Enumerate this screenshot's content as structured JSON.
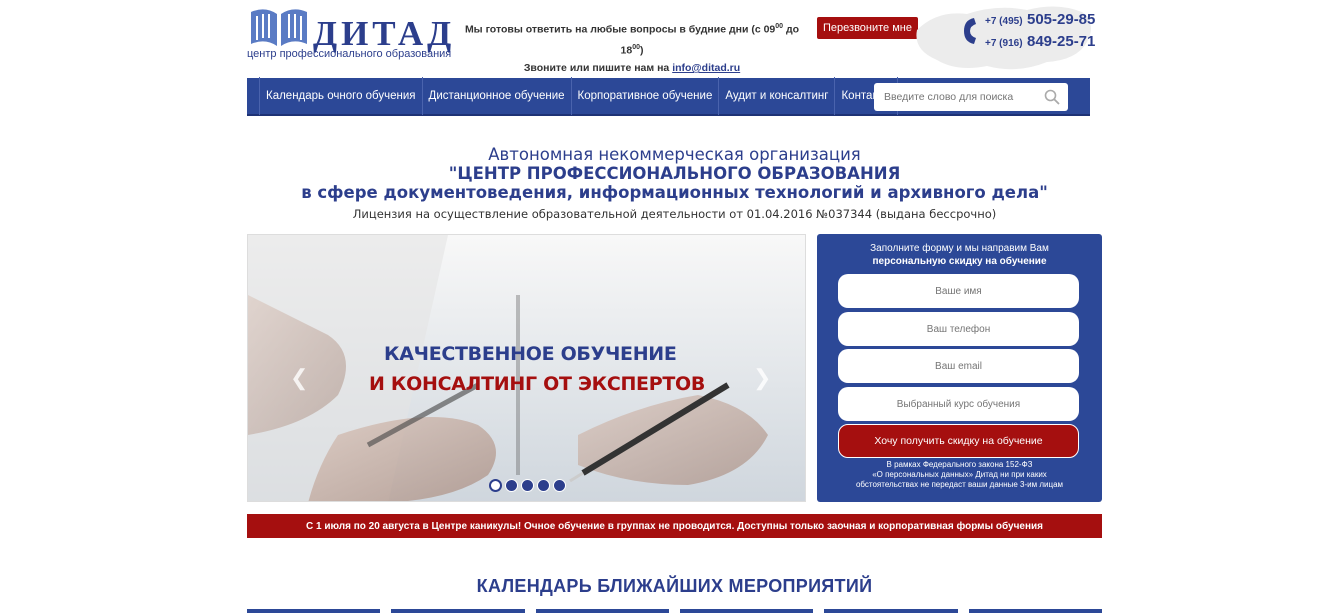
{
  "brand": {
    "name": "ДИТАД",
    "subtitle": "центр профессионального образования"
  },
  "contact": {
    "line1_prefix": "Мы готовы ответить на любые вопросы в будние дни (с 09",
    "line1_sup1": "00",
    "line1_mid": " до 18",
    "line1_sup2": "00",
    "line1_suffix": ")",
    "line2_prefix": "Звоните или пишите нам на ",
    "email": "info@ditad.ru"
  },
  "callback_label": "Перезвоните мне",
  "phones": [
    {
      "code": "+7 (495)",
      "number": "505-29-85"
    },
    {
      "code": "+7 (916)",
      "number": "849-25-71"
    }
  ],
  "nav": {
    "items": [
      {
        "label": "Календарь очного обучения"
      },
      {
        "label": "Дистанционное обучение"
      },
      {
        "label": "Корпоративное обучение"
      },
      {
        "label": "Аудит и консалтинг"
      },
      {
        "label": "Контакты"
      }
    ],
    "search_placeholder": "Введите слово для поиска"
  },
  "heading": {
    "line1": "Автономная некоммерческая организация",
    "line2": "\"ЦЕНТР ПРОФЕССИОНАЛЬНОГО ОБРАЗОВАНИЯ",
    "line3": "в сфере документоведения, информационных технологий и архивного дела\"",
    "license": "Лицензия на осуществление образовательной деятельности от 01.04.2016 №037344 (выдана бессрочно)"
  },
  "slider": {
    "line1": "КАЧЕСТВЕННОЕ ОБУЧЕНИЕ",
    "line2": "И КОНСАЛТИНГ ОТ ЭКСПЕРТОВ",
    "slide_count": 5,
    "active_slide": 1
  },
  "form": {
    "title_line1": "Заполните форму и мы направим Вам",
    "title_line2": "персональную скидку на обучение",
    "fields": [
      {
        "placeholder": "Ваше имя"
      },
      {
        "placeholder": "Ваш телефон"
      },
      {
        "placeholder": "Ваш email"
      },
      {
        "placeholder": "Выбранный курс обучения"
      }
    ],
    "submit_label": "Хочу получить скидку на обучение",
    "note_line1": "В рамках Федерального закона 152-ФЗ",
    "note_line2": "«О персональных данных» Дитад ни при каких",
    "note_line3": "обстоятельствах не передаст ваши данные 3-им лицам"
  },
  "notice": "С 1 июля по 20 августа в Центре каникулы! Очное обучение в группах не проводится. Доступны только заочная и корпоративная формы обучения",
  "section_title": "КАЛЕНДАРЬ БЛИЖАЙШИХ МЕРОПРИЯТИЙ",
  "colors": {
    "brand_blue": "#2c4897",
    "accent_red": "#a50f0f"
  }
}
